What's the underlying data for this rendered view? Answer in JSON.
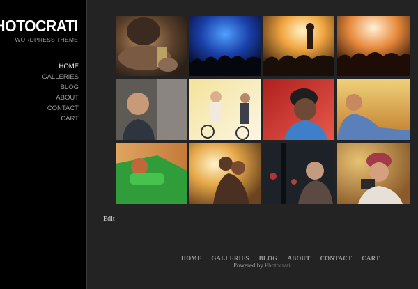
{
  "site": {
    "title": "PHOTOCRATI",
    "tagline": "WORDPRESS THEME"
  },
  "nav": {
    "items": [
      {
        "label": "HOME",
        "active": true
      },
      {
        "label": "GALLERIES",
        "active": false
      },
      {
        "label": "BLOG",
        "active": false
      },
      {
        "label": "ABOUT",
        "active": false
      },
      {
        "label": "CONTACT",
        "active": false
      },
      {
        "label": "CART",
        "active": false
      }
    ]
  },
  "gallery": {
    "photos": [
      {
        "name": "photo-man-with-keys",
        "scene": "portrait-warm"
      },
      {
        "name": "photo-concert-blue",
        "scene": "concert-blue"
      },
      {
        "name": "photo-concert-guitarist",
        "scene": "concert-gold"
      },
      {
        "name": "photo-concert-crowd",
        "scene": "concert-orange"
      },
      {
        "name": "photo-smiling-man-headphones",
        "scene": "portrait-gray"
      },
      {
        "name": "photo-couple-bicycles",
        "scene": "bright-yellow"
      },
      {
        "name": "photo-man-red-background",
        "scene": "red-portrait"
      },
      {
        "name": "photo-woman-field",
        "scene": "warm-field"
      },
      {
        "name": "photo-woman-car-window",
        "scene": "green-car"
      },
      {
        "name": "photo-couple-kiss-sunset",
        "scene": "sunset-couple"
      },
      {
        "name": "photo-woman-night-city",
        "scene": "night-city"
      },
      {
        "name": "photo-woman-camera",
        "scene": "camera-girl"
      }
    ]
  },
  "content": {
    "edit_label": "Edit"
  },
  "footer": {
    "links": [
      "HOME",
      "GALLERIES",
      "BLOG",
      "ABOUT",
      "CONTACT",
      "CART"
    ],
    "powered_prefix": "Powered by",
    "powered_brand": "Photocrati"
  },
  "colors": {
    "background": "#232323",
    "sidebar": "#000000",
    "nav_active": "#ffffff",
    "nav_inactive": "#9c9c9c"
  }
}
